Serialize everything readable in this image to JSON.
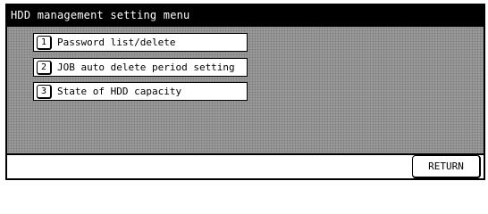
{
  "window": {
    "title": "HDD management setting menu"
  },
  "menu": {
    "items": [
      {
        "number": "1",
        "label": "Password list/delete"
      },
      {
        "number": "2",
        "label": "JOB auto delete period setting"
      },
      {
        "number": "3",
        "label": "State of HDD capacity"
      }
    ]
  },
  "footer": {
    "return_label": "RETURN"
  }
}
